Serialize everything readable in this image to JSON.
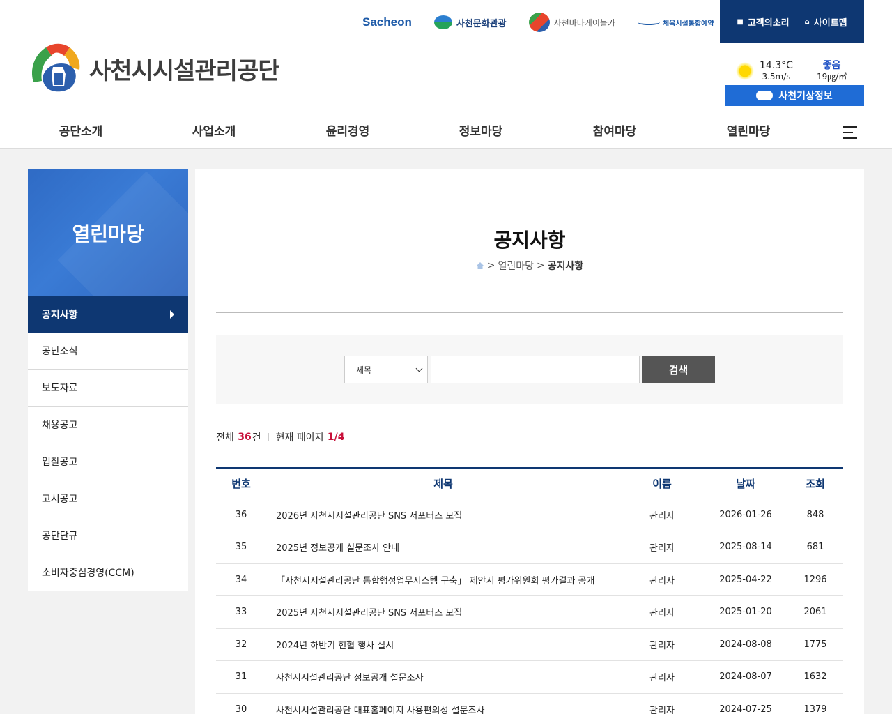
{
  "org": {
    "name": "사천시시설관리공단"
  },
  "family_links": [
    "Sacheon",
    "사천문화관광",
    "사천바다케이블카",
    "체육시설통합예약"
  ],
  "util_links": {
    "voice": "고객의소리",
    "sitemap": "사이트맵"
  },
  "weather": {
    "temp": "14.3°C",
    "wind": "3.5m/s",
    "air_grade": "좋음",
    "air_value": "19㎍/㎥",
    "button": "사천기상정보"
  },
  "gnb": [
    "공단소개",
    "사업소개",
    "윤리경영",
    "정보마당",
    "참여마당",
    "열린마당"
  ],
  "sidebar": {
    "title": "열린마당",
    "items": [
      "공지사항",
      "공단소식",
      "보도자료",
      "채용공고",
      "입찰공고",
      "고시공고",
      "공단단규",
      "소비자중심경영(CCM)"
    ]
  },
  "page": {
    "title": "공지사항",
    "breadcrumb": {
      "sep1": ">",
      "parent": "열린마당",
      "sep2": ">",
      "current": "공지사항"
    }
  },
  "search": {
    "select_value": "제목",
    "input_value": "",
    "button": "검색"
  },
  "count": {
    "total_label": "전체",
    "total": "36",
    "total_unit": "건",
    "page_label": "현재 페이지",
    "page": "1/4"
  },
  "table": {
    "headers": [
      "번호",
      "제목",
      "이름",
      "날짜",
      "조회"
    ],
    "rows": [
      [
        "36",
        "2026년 사천시시설관리공단 SNS 서포터즈 모집",
        "관리자",
        "2026-01-26",
        "848"
      ],
      [
        "35",
        "2025년 정보공개 설문조사 안내",
        "관리자",
        "2025-08-14",
        "681"
      ],
      [
        "34",
        "「사천시시설관리공단 통합행정업무시스템 구축」 제안서 평가위원회 평가결과 공개",
        "관리자",
        "2025-04-22",
        "1296"
      ],
      [
        "33",
        "2025년 사천시시설관리공단 SNS 서포터즈 모집",
        "관리자",
        "2025-01-20",
        "2061"
      ],
      [
        "32",
        "2024년 하반기 헌혈 행사 실시",
        "관리자",
        "2024-08-08",
        "1775"
      ],
      [
        "31",
        "사천시시설관리공단 정보공개 설문조사",
        "관리자",
        "2024-08-07",
        "1632"
      ],
      [
        "30",
        "사천시시설관리공단 대표홈페이지 사용편의성 설문조사",
        "관리자",
        "2024-07-25",
        "1379"
      ]
    ]
  },
  "colors": {
    "navy": "#0e3772",
    "blue": "#1f6cd6",
    "red": "#c8103a"
  }
}
